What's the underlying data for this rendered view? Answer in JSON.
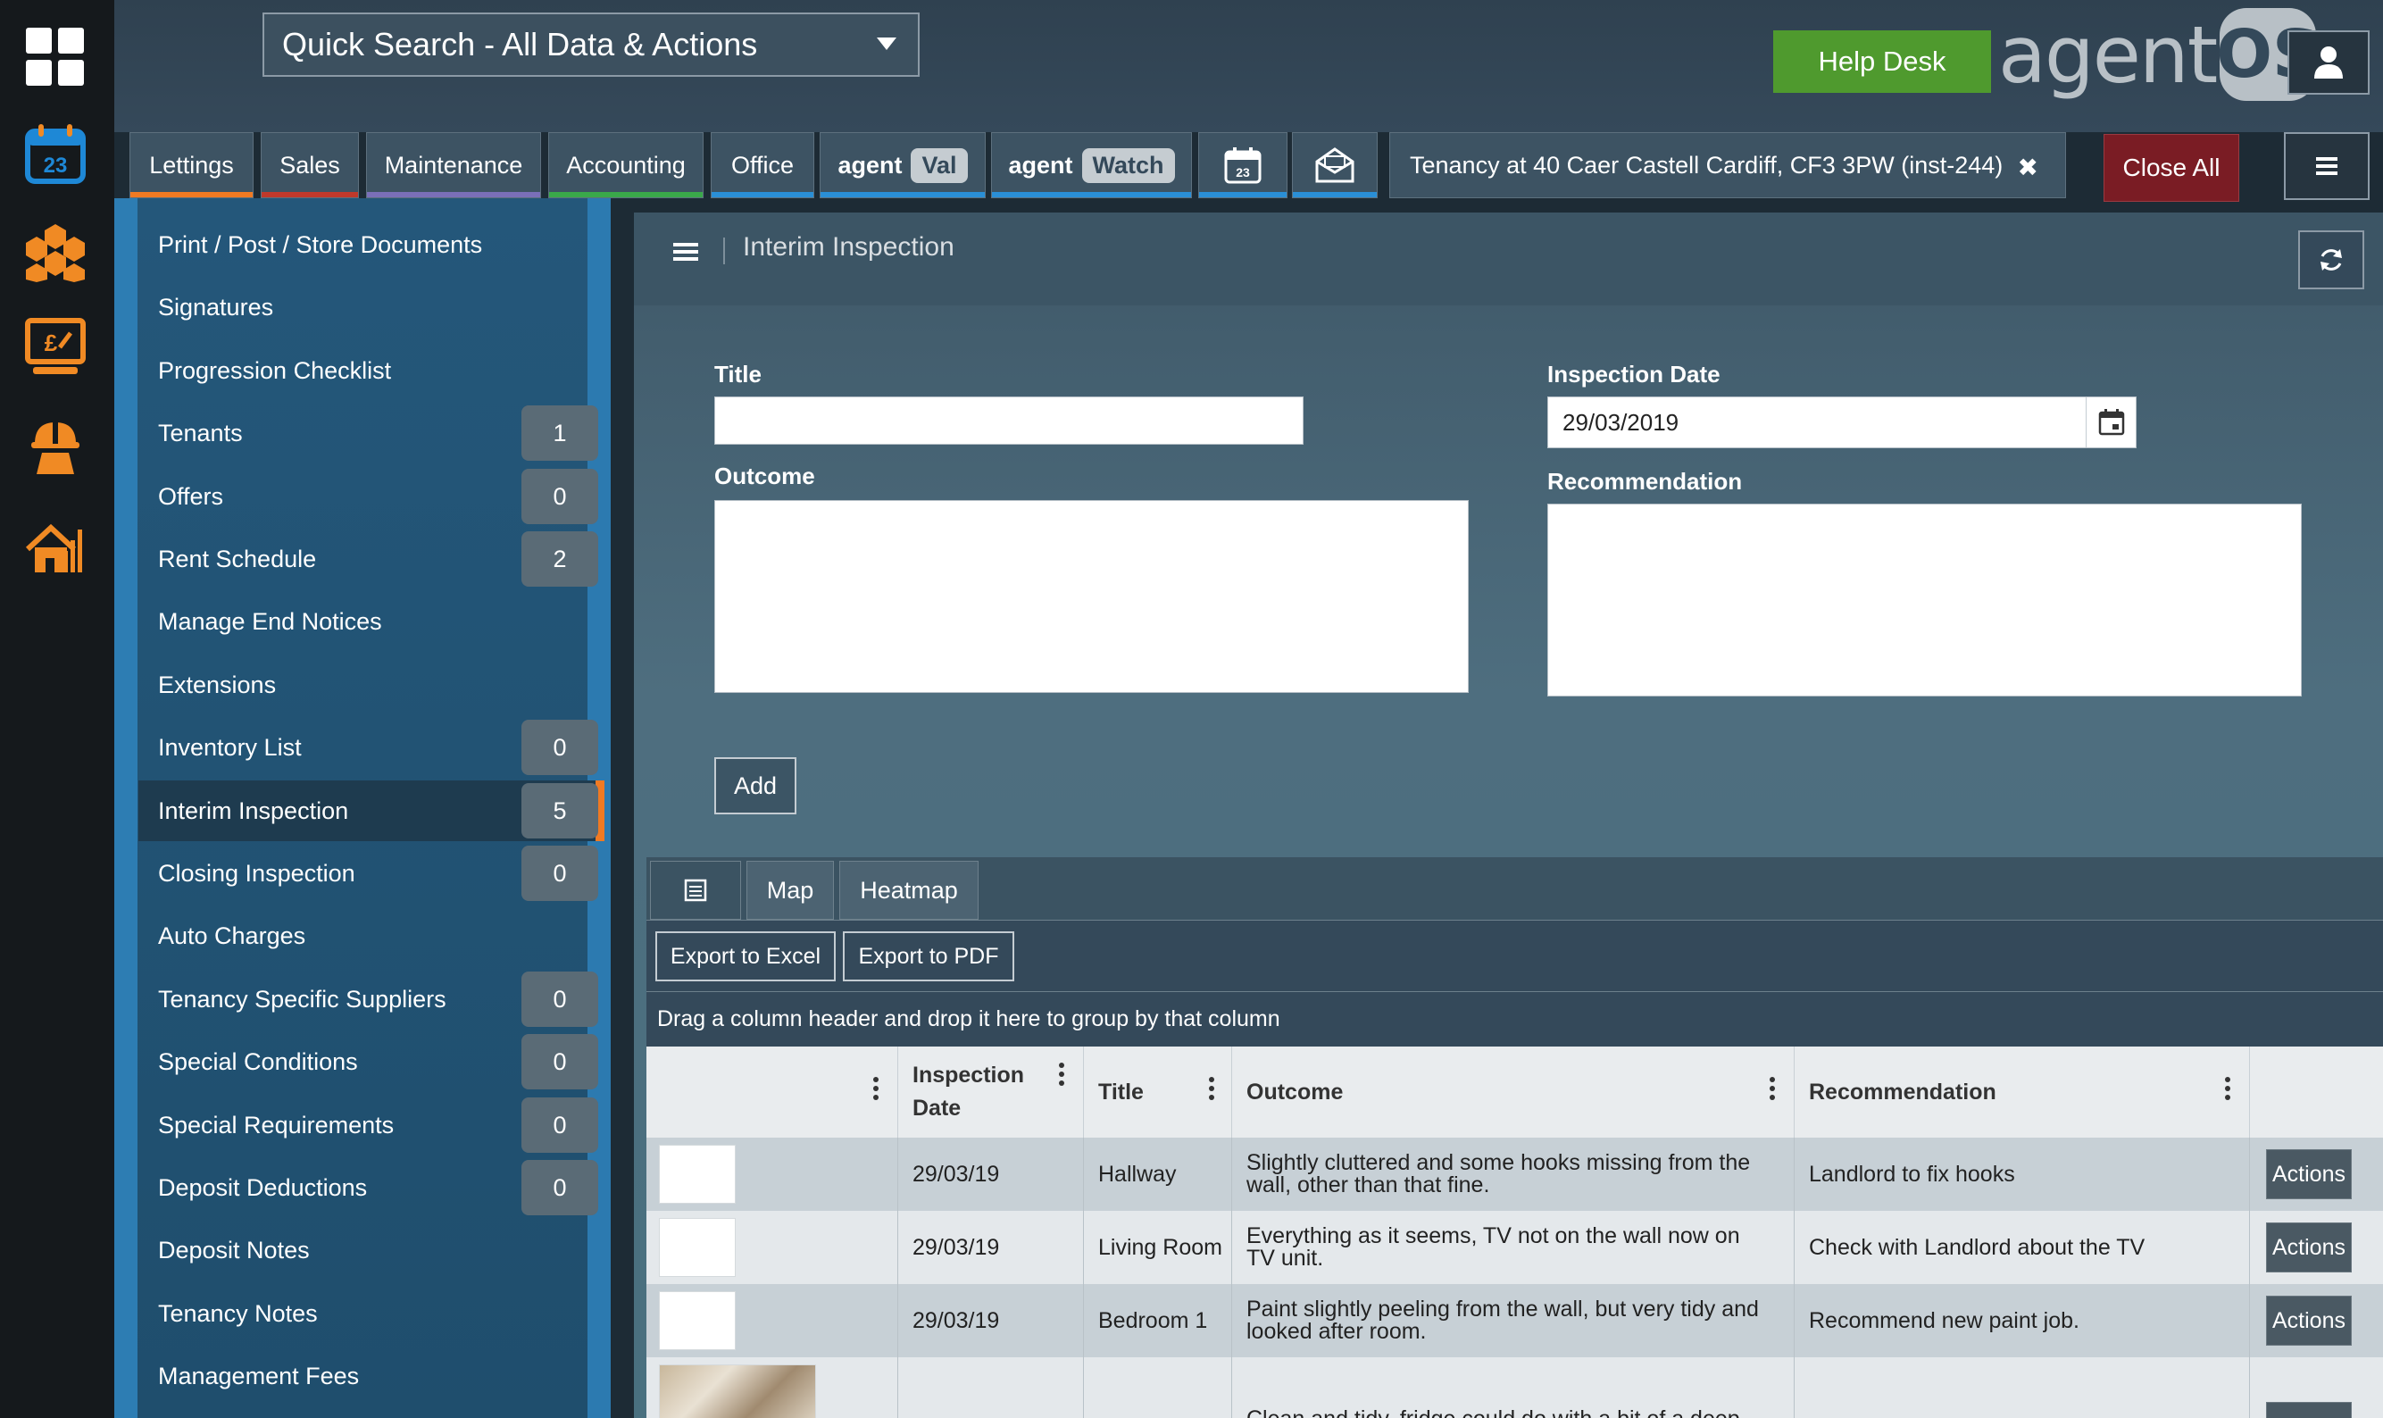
{
  "rail": {
    "icons": [
      "dashboard-grid-icon",
      "calendar-icon",
      "honeycomb-icon",
      "finance-presentation-icon",
      "maintenance-worker-icon",
      "property-chart-icon"
    ],
    "calendar_day": "23",
    "accent": "#f08a24",
    "calendar_color": "#1e88d6"
  },
  "header": {
    "quick_search": "Quick Search - All Data & Actions",
    "help_desk": "Help Desk",
    "logo_text": "agent",
    "logo_badge": "OS"
  },
  "tabs": [
    {
      "label": "Lettings",
      "color": "#f07a23"
    },
    {
      "label": "Sales",
      "color": "#c0392b"
    },
    {
      "label": "Maintenance",
      "color": "#7a6fb8"
    },
    {
      "label": "Accounting",
      "color": "#3aa84a"
    },
    {
      "label": "Office",
      "color": "#2a8fd6"
    },
    {
      "label": "agent",
      "pill": "Val",
      "color": "#2a8fd6"
    },
    {
      "label": "agent",
      "pill": "Watch",
      "color": "#2a8fd6"
    }
  ],
  "record_tab": {
    "label": "Tenancy at 40 Caer Castell Cardiff, CF3 3PW (inst-244)",
    "close": "✖"
  },
  "close_all": "Close All",
  "nav": [
    {
      "label": "Print / Post / Store Documents"
    },
    {
      "label": "Signatures"
    },
    {
      "label": "Progression Checklist"
    },
    {
      "label": "Tenants",
      "count": "1"
    },
    {
      "label": "Offers",
      "count": "0"
    },
    {
      "label": "Rent Schedule",
      "count": "2"
    },
    {
      "label": "Manage End Notices"
    },
    {
      "label": "Extensions"
    },
    {
      "label": "Inventory List",
      "count": "0"
    },
    {
      "label": "Interim Inspection",
      "count": "5",
      "active": true
    },
    {
      "label": "Closing Inspection",
      "count": "0"
    },
    {
      "label": "Auto Charges"
    },
    {
      "label": "Tenancy Specific Suppliers",
      "count": "0"
    },
    {
      "label": "Special Conditions",
      "count": "0"
    },
    {
      "label": "Special Requirements",
      "count": "0"
    },
    {
      "label": "Deposit Deductions",
      "count": "0"
    },
    {
      "label": "Deposit Notes"
    },
    {
      "label": "Tenancy Notes"
    },
    {
      "label": "Management Fees"
    }
  ],
  "form": {
    "section_title": "Interim Inspection",
    "title_label": "Title",
    "title_value": "",
    "inspection_date_label": "Inspection Date",
    "inspection_date_value": "29/03/2019",
    "outcome_label": "Outcome",
    "outcome_value": "",
    "recommendation_label": "Recommendation",
    "recommendation_value": "",
    "add_button": "Add"
  },
  "grid": {
    "view_tabs": [
      "Map",
      "Heatmap"
    ],
    "export_excel": "Export to Excel",
    "export_pdf": "Export to PDF",
    "group_hint": "Drag a column header and drop it here to group by that column",
    "columns": [
      "",
      "Inspection Date",
      "Title",
      "Outcome",
      "Recommendation",
      ""
    ],
    "rows": [
      {
        "date": "29/03/19",
        "title": "Hallway",
        "outcome": "Slightly cluttered and some hooks missing from the wall, other than that fine.",
        "recommendation": "Landlord to fix hooks",
        "action": "Actions"
      },
      {
        "date": "29/03/19",
        "title": "Living Room",
        "outcome": "Everything as it seems, TV not on the wall now on TV unit.",
        "recommendation": "Check with Landlord about the TV",
        "action": "Actions"
      },
      {
        "date": "29/03/19",
        "title": "Bedroom 1",
        "outcome": "Paint slightly peeling from the wall, but very tidy and looked after room.",
        "recommendation": "Recommend new paint job.",
        "action": "Actions"
      },
      {
        "date": "",
        "title": "",
        "outcome": "Clean and tidy, fridge could do with a bit of a deep",
        "recommendation": "",
        "action": ""
      }
    ]
  }
}
